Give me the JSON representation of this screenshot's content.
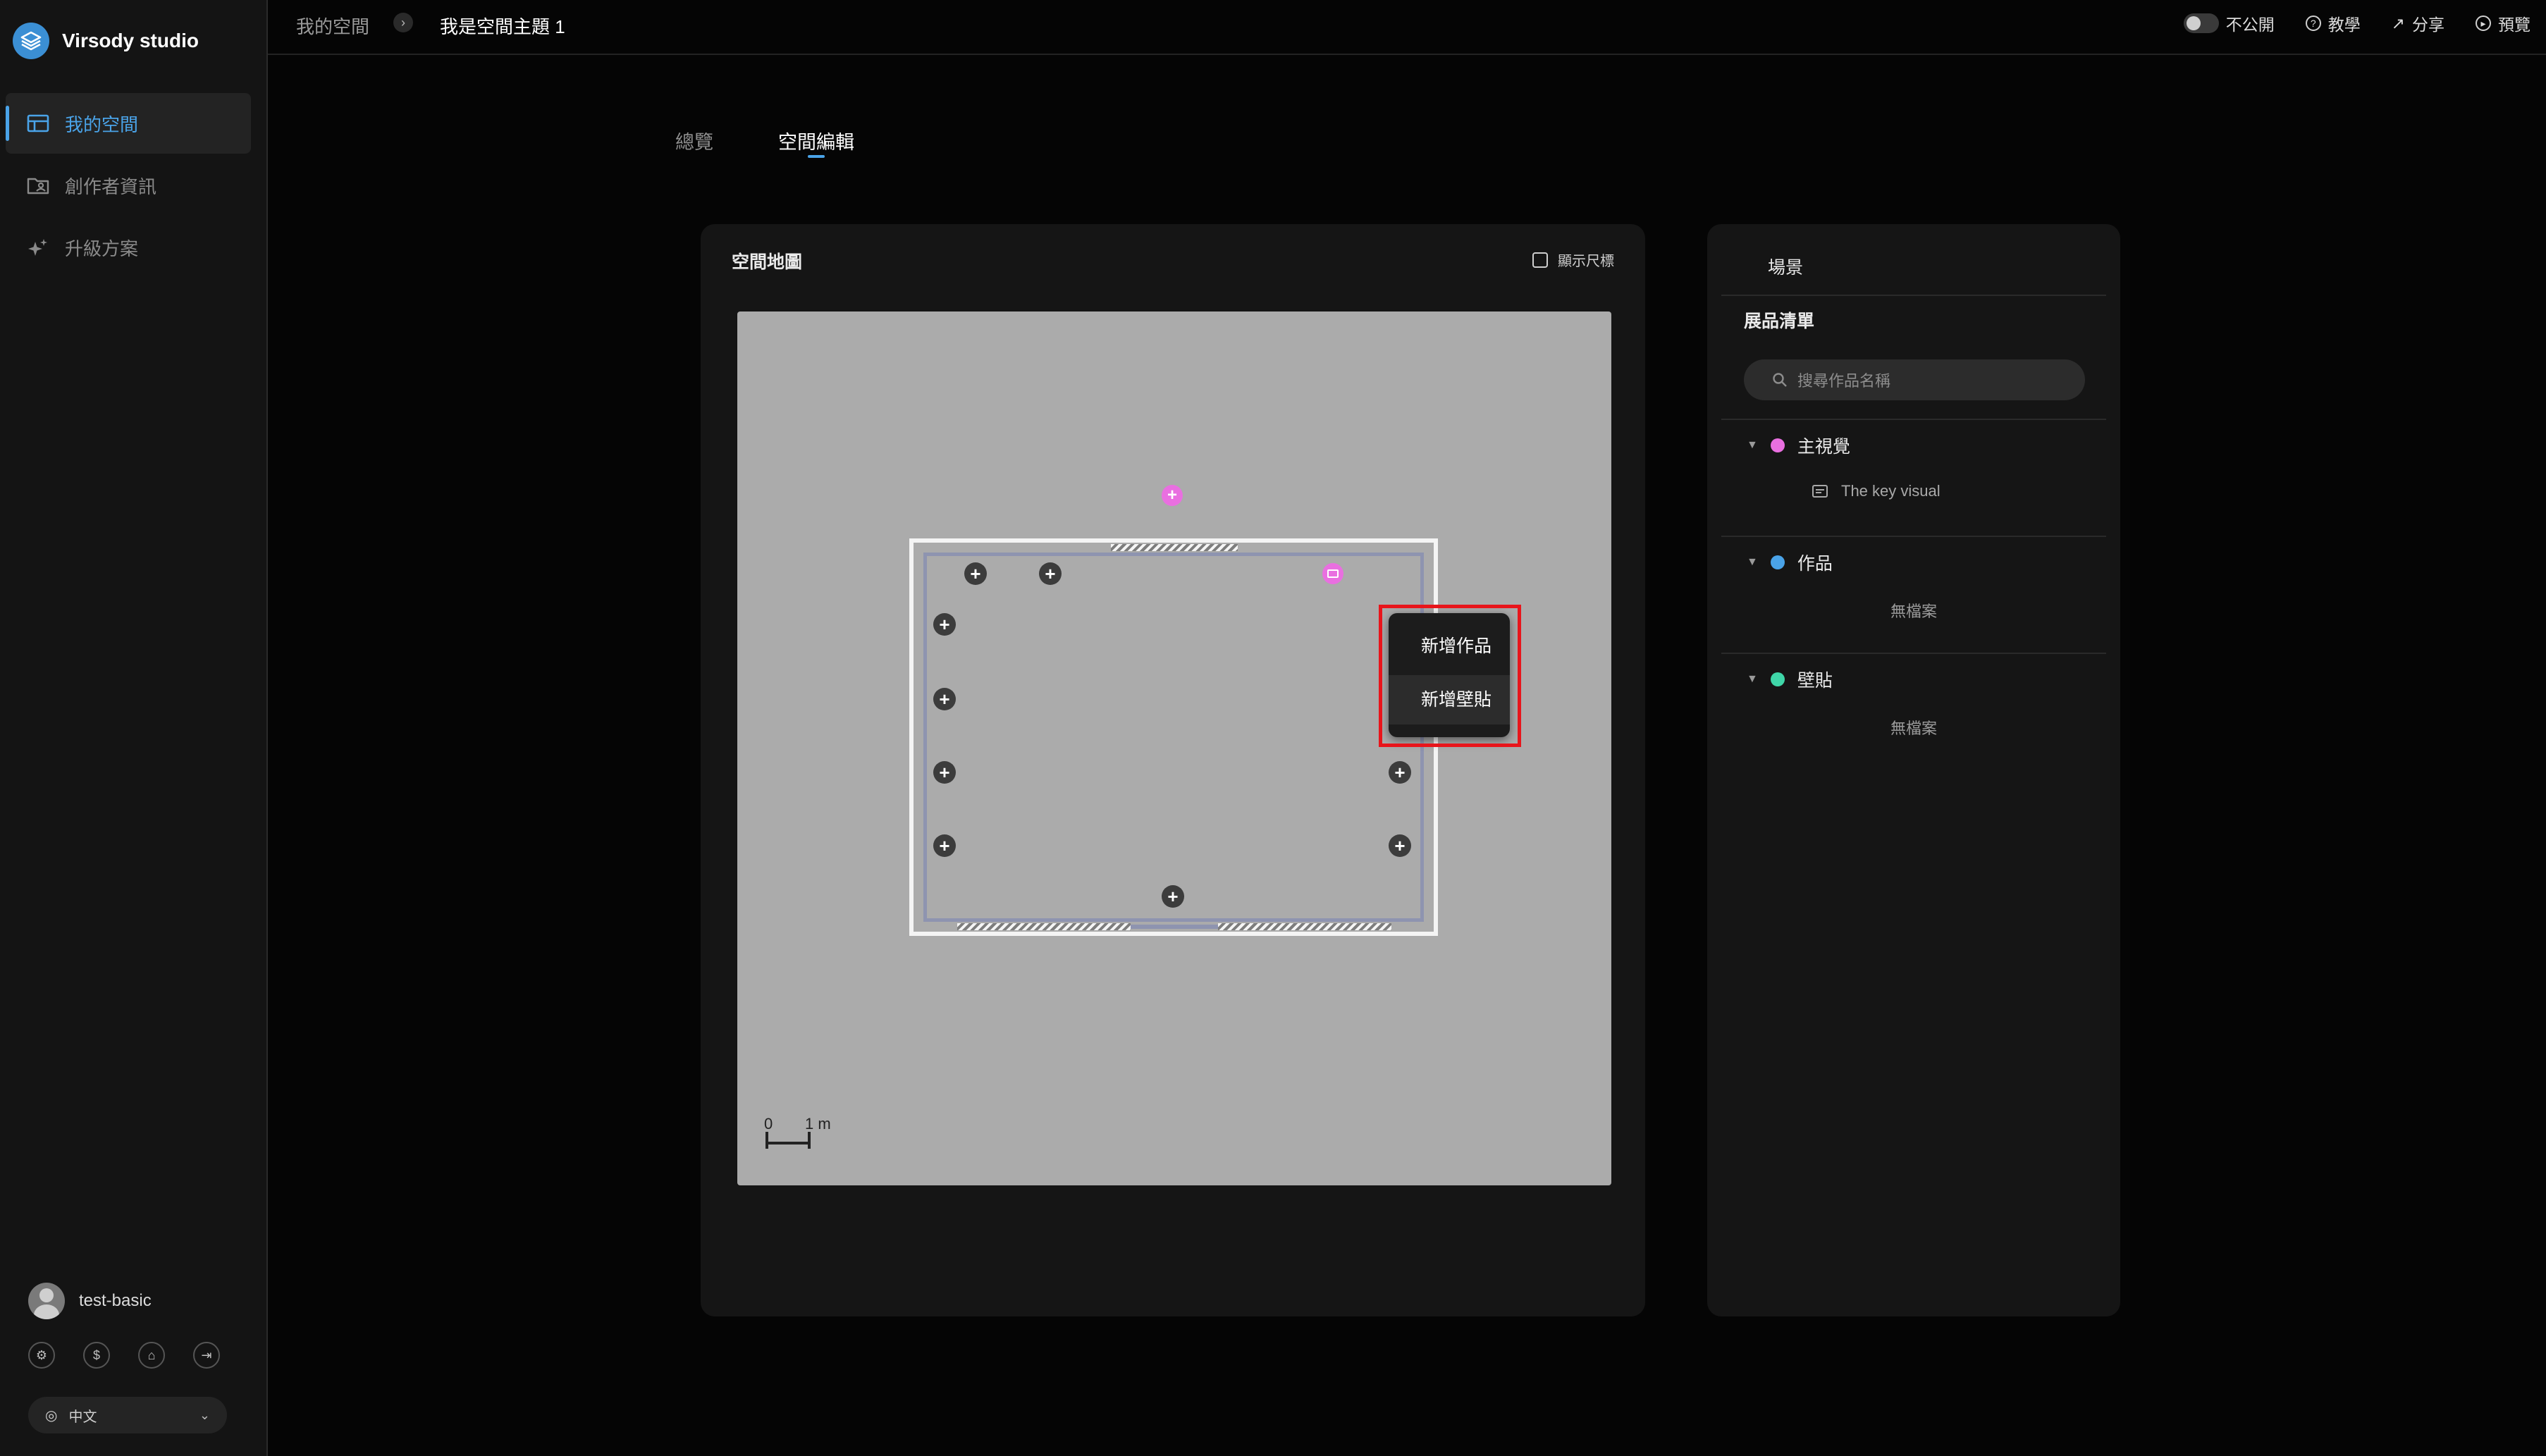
{
  "app": {
    "brand_name": "Virsody studio",
    "accent_color": "#4aa3e8"
  },
  "sidebar": {
    "items": [
      {
        "label": "我的空間",
        "icon": "layout-icon",
        "active": true
      },
      {
        "label": "創作者資訊",
        "icon": "folder-user-icon",
        "active": false
      },
      {
        "label": "升級方案",
        "icon": "sparkle-icon",
        "active": false
      }
    ],
    "user": {
      "name": "test-basic"
    },
    "footer_icons": [
      "gear-icon",
      "dollar-icon",
      "home-icon",
      "logout-icon"
    ],
    "language": {
      "selected": "中文"
    }
  },
  "topbar": {
    "breadcrumb": [
      "我的空間",
      "我是空間主題 1"
    ],
    "actions": {
      "visibility": "不公開",
      "tutorial": "教學",
      "share": "分享",
      "preview": "預覽"
    }
  },
  "tabs": {
    "overview": "總覽",
    "edit": "空間編輯",
    "active": "edit"
  },
  "map": {
    "title": "空間地圖",
    "ruler_toggle": "顯示尺標",
    "ruler_checked": false,
    "scale": {
      "start": "0",
      "end": "1 m"
    },
    "context_menu": {
      "items": [
        "新增作品",
        "新增壁貼"
      ]
    }
  },
  "panel": {
    "scene_tab": "場景",
    "list_title": "展品清單",
    "search_placeholder": "搜尋作品名稱",
    "groups": [
      {
        "name": "主視覺",
        "color": "#e96fe0",
        "items": [
          "The key visual"
        ]
      },
      {
        "name": "作品",
        "color": "#4aa3e8",
        "empty_text": "無檔案"
      },
      {
        "name": "壁貼",
        "color": "#3fd6a8",
        "empty_text": "無檔案"
      }
    ]
  }
}
